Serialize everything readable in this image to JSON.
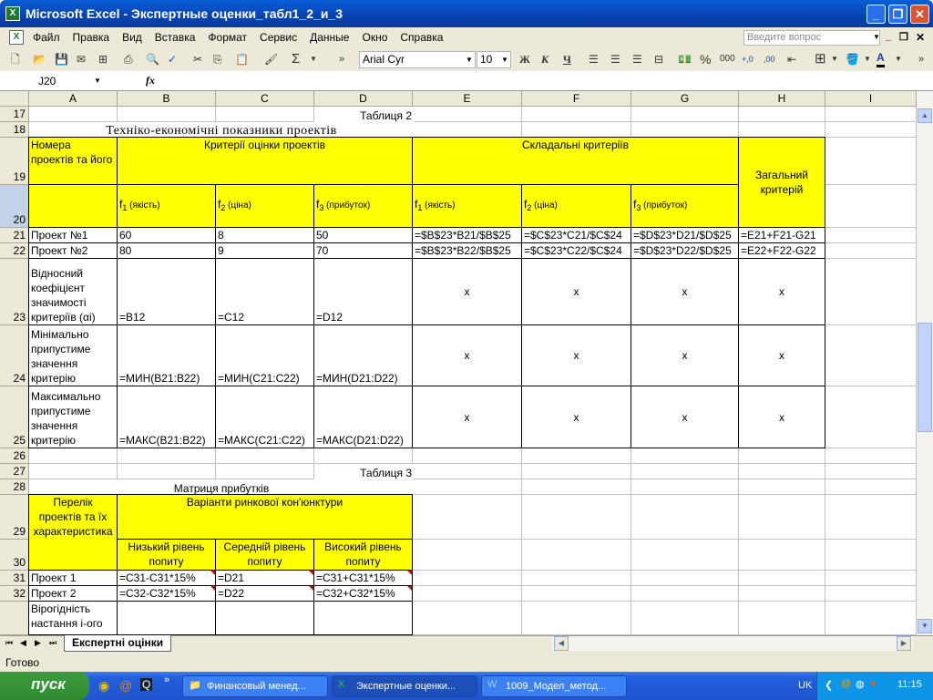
{
  "window": {
    "title": "Microsoft Excel - Экспертные оценки_табл1_2_и_3"
  },
  "menu": [
    "Файл",
    "Правка",
    "Вид",
    "Вставка",
    "Формат",
    "Сервис",
    "Данные",
    "Окно",
    "Справка"
  ],
  "ask_placeholder": "Введите вопрос",
  "toolbar": {
    "font": "Arial Cyr",
    "size": "10",
    "sigma": "Σ",
    "bold": "Ж",
    "italic": "К",
    "underline": "Ч",
    "percent": "%",
    "thousands": "000",
    "inc_dec": "+,0",
    "dec_dec": ",00"
  },
  "formula_bar": {
    "name_box": "J20",
    "fx": "fx",
    "content": ""
  },
  "columns": [
    "A",
    "B",
    "C",
    "D",
    "E",
    "F",
    "G",
    "H",
    "I"
  ],
  "rows": [
    "17",
    "18",
    "19",
    "20",
    "21",
    "22",
    "23",
    "24",
    "25",
    "26",
    "27",
    "28",
    "29",
    "30",
    "31",
    "32",
    ""
  ],
  "active_row": "20",
  "cells": [
    {
      "ref": "D17",
      "text": "Таблиця 2"
    },
    {
      "ref": "A18:D18",
      "text": "Техніко-економічні показники проектів"
    },
    {
      "ref": "A19",
      "text": "Номера проектів та його"
    },
    {
      "ref": "B19:D19",
      "text": "Критерії оцінки проектів"
    },
    {
      "ref": "E19:G19",
      "text": "Складальні критеріїв"
    },
    {
      "ref": "H19:H20",
      "text": "Загальний кpитерій"
    },
    {
      "ref": "A20",
      "text": ""
    },
    {
      "ref": "B20",
      "f": "f",
      "sub": "1",
      "note": " (якість)"
    },
    {
      "ref": "C20",
      "f": "f",
      "sub": "2",
      "note": " (ціна)"
    },
    {
      "ref": "D20",
      "f": "f",
      "sub": "3",
      "note": " (прибуток)"
    },
    {
      "ref": "E20",
      "f": "f",
      "sub": "1",
      "note": " (якість)"
    },
    {
      "ref": "F20",
      "f": "f",
      "sub": "2",
      "note": " (ціна)"
    },
    {
      "ref": "G20",
      "f": "f",
      "sub": "3",
      "note": " (прибуток)"
    },
    {
      "ref": "A21",
      "text": "Проект №1"
    },
    {
      "ref": "B21",
      "text": "60"
    },
    {
      "ref": "C21",
      "text": "8"
    },
    {
      "ref": "D21",
      "text": "50"
    },
    {
      "ref": "E21",
      "text": "=$B$23*B21/$B$25"
    },
    {
      "ref": "F21",
      "text": "=$C$23*C21/$C$24"
    },
    {
      "ref": "G21",
      "text": "=$D$23*D21/$D$25"
    },
    {
      "ref": "H21",
      "text": "=E21+F21-G21"
    },
    {
      "ref": "A22",
      "text": "Проект №2"
    },
    {
      "ref": "B22",
      "text": "80"
    },
    {
      "ref": "C22",
      "text": "9"
    },
    {
      "ref": "D22",
      "text": "70"
    },
    {
      "ref": "E22",
      "text": "=$B$23*B22/$B$25"
    },
    {
      "ref": "F22",
      "text": "=$C$23*C22/$C$24"
    },
    {
      "ref": "G22",
      "text": "=$D$23*D22/$D$25"
    },
    {
      "ref": "H22",
      "text": "=E22+F22-G22"
    },
    {
      "ref": "A23",
      "text": "Відносний коефіцієнт значимості критеріїв (αi)"
    },
    {
      "ref": "B23",
      "text": "=B12"
    },
    {
      "ref": "C23",
      "text": "=C12"
    },
    {
      "ref": "D23",
      "text": "=D12"
    },
    {
      "ref": "E23",
      "text": "x"
    },
    {
      "ref": "F23",
      "text": "x"
    },
    {
      "ref": "G23",
      "text": "x"
    },
    {
      "ref": "H23",
      "text": "x"
    },
    {
      "ref": "A24",
      "text": "Мінімально припустиме значення критерію"
    },
    {
      "ref": "B24",
      "text": "=МИН(B21:B22)"
    },
    {
      "ref": "C24",
      "text": "=МИН(C21:C22)"
    },
    {
      "ref": "D24",
      "text": "=МИН(D21:D22)"
    },
    {
      "ref": "E24",
      "text": "x"
    },
    {
      "ref": "F24",
      "text": "x"
    },
    {
      "ref": "G24",
      "text": "x"
    },
    {
      "ref": "H24",
      "text": "x"
    },
    {
      "ref": "A25",
      "text": "Максимально припустиме значення критерію"
    },
    {
      "ref": "B25",
      "text": "=МАКС(B21:B22)"
    },
    {
      "ref": "C25",
      "text": "=МАКС(C21:C22)"
    },
    {
      "ref": "D25",
      "text": "=МАКС(D21:D22)"
    },
    {
      "ref": "E25",
      "text": "x"
    },
    {
      "ref": "F25",
      "text": "x"
    },
    {
      "ref": "G25",
      "text": "x"
    },
    {
      "ref": "H25",
      "text": "x"
    },
    {
      "ref": "D27",
      "text": "Таблиця 3"
    },
    {
      "ref": "A28:D28",
      "text": "Матриця прибутків"
    },
    {
      "ref": "A29:A30",
      "text": "Перелік проектів та їх характеристика"
    },
    {
      "ref": "B29:D29",
      "text": "Варіанти ринкової кон'юнктури"
    },
    {
      "ref": "B30",
      "text": "Низький рівень попиту"
    },
    {
      "ref": "C30",
      "text": "Середній рівень попиту"
    },
    {
      "ref": "D30",
      "text": "Високий рівень попиту"
    },
    {
      "ref": "A31",
      "text": "Проект 1"
    },
    {
      "ref": "B31",
      "text": "=C31-C31*15%"
    },
    {
      "ref": "C31",
      "text": "=D21"
    },
    {
      "ref": "D31",
      "text": "=C31+C31*15%"
    },
    {
      "ref": "A32",
      "text": "Проект 2"
    },
    {
      "ref": "B32",
      "text": "=C32-C32*15%"
    },
    {
      "ref": "C32",
      "text": "=D22"
    },
    {
      "ref": "D32",
      "text": "=C32+C32*15%"
    },
    {
      "ref": "A33",
      "text": "Вірогідність настання  і-ого"
    },
    {
      "ref": "B33",
      "text": ""
    },
    {
      "ref": "C33",
      "text": ""
    },
    {
      "ref": "D33",
      "text": ""
    }
  ],
  "sheet_tab": "Експертні оцінки",
  "status": "Готово",
  "taskbar": {
    "start": "пуск",
    "tasks": [
      "Финансовый менед...",
      "Экспертные оценки...",
      "1009_Модел_метод..."
    ],
    "lang": "UK",
    "clock": "11:15"
  },
  "colors": {
    "header_fill": "#ffff00",
    "title_bar": "#0842b0"
  }
}
